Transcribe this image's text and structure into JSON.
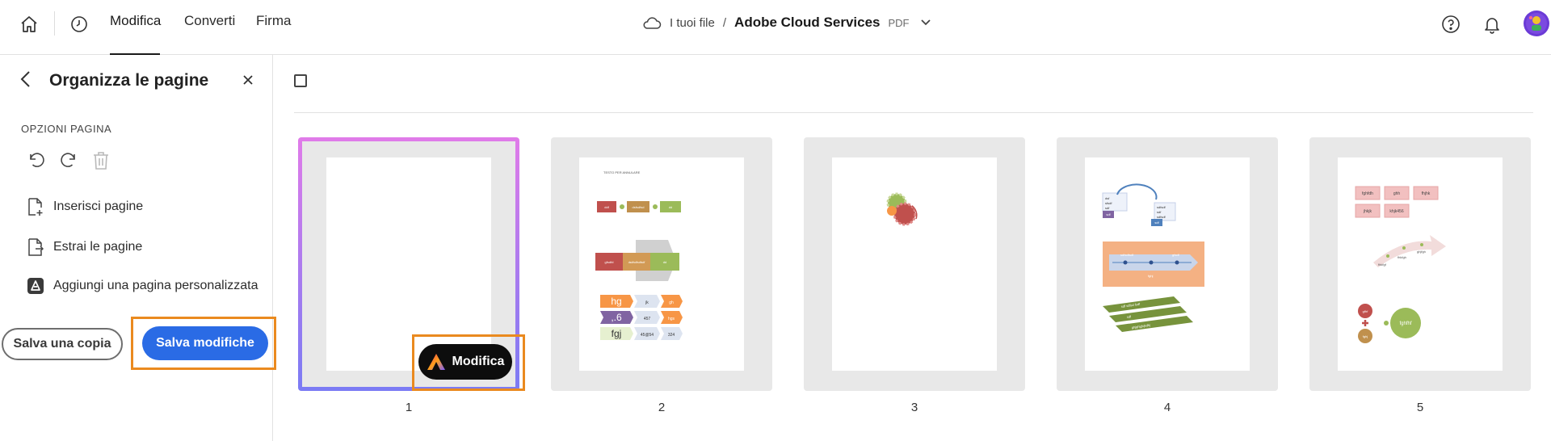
{
  "topbar": {
    "tabs": [
      {
        "label": "Modifica",
        "active": true
      },
      {
        "label": "Converti",
        "active": false
      },
      {
        "label": "Firma",
        "active": false
      }
    ],
    "breadcrumb": {
      "files": "I tuoi file",
      "separator": "/",
      "document": "Adobe Cloud Services",
      "type": "PDF"
    }
  },
  "sidebar": {
    "title": "Organizza le pagine",
    "section": "OPZIONI PAGINA",
    "items": [
      {
        "label": "Inserisci pagine",
        "icon": "insert-page-icon"
      },
      {
        "label": "Estrai le pagine",
        "icon": "extract-page-icon"
      },
      {
        "label": "Aggiungi una pagina personalizzata",
        "icon": "adobe-express-icon"
      }
    ],
    "save_copy": "Salva una copia",
    "save_changes": "Salva modifiche"
  },
  "pages": [
    {
      "number": "1",
      "selected": true
    },
    {
      "number": "2",
      "selected": false
    },
    {
      "number": "3",
      "selected": false
    },
    {
      "number": "4",
      "selected": false
    },
    {
      "number": "5",
      "selected": false
    }
  ],
  "edit_button": "Modifica",
  "thumbnails": {
    "p2": {
      "heading": "TESTO PER ANNULARE",
      "row1": [
        "ddf",
        "dsfsdfsd",
        "dd"
      ],
      "row2": [
        "gfsdfd",
        "dsdfsdfsdfsdf",
        "dd"
      ],
      "rows": [
        [
          "hg",
          "jk",
          "gh"
        ],
        [
          ",.6",
          "457",
          "hgs"
        ],
        [
          "fgj",
          "45@54",
          "324"
        ]
      ]
    },
    "p4": {
      "list1": [
        "dsf",
        "sfsdf",
        "sdf"
      ],
      "list2": [
        "sdfsdf",
        "sdf",
        "sdfsdf"
      ],
      "box1": "sdf",
      "box2": "sdf",
      "timeline": [
        "sdfsdfsdf",
        "gfsdf"
      ],
      "timeline_sub": "fghj",
      "bars": [
        "sdf sdfsd fsdf",
        "sdf",
        "ghjghjghjkdhj"
      ]
    },
    "p5": {
      "tags_row1": [
        "fghfdh",
        "ghh",
        "fhjhk"
      ],
      "tags_row2": [
        "jhkjk",
        "khjk456"
      ],
      "arrow_labels": [
        "fhkfgf",
        "fhkfgh",
        "ghjfgh"
      ],
      "circle_small": [
        "gfhf",
        "fghj"
      ],
      "circle_big": "fghfhf"
    }
  },
  "colors": {
    "accent": "#2a6be5",
    "highlight": "#ea8a1f",
    "selection_top": "#e07be9",
    "selection_bottom": "#7b7bf4"
  }
}
